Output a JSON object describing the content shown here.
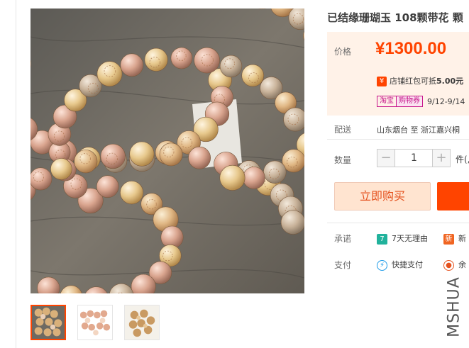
{
  "product": {
    "title": "已结缘珊瑚玉 108颗带花 颗",
    "watermark": "MSHUA"
  },
  "price": {
    "label": "价格",
    "value": "¥1300.00",
    "coupon_icon": "¥",
    "coupon_text": "店铺红包可抵",
    "coupon_amount": "5.00元",
    "promo_tag_1": "淘宝",
    "promo_tag_2": "购物券",
    "promo_dates": "9/12-9/14"
  },
  "shipping": {
    "label": "配送",
    "value": "山东烟台 至  浙江嘉兴桐"
  },
  "quantity": {
    "label": "数量",
    "minus": "−",
    "value": "1",
    "plus": "+",
    "unit": "件(,"
  },
  "actions": {
    "buy_now": "立即购买"
  },
  "promise": {
    "label": "承诺",
    "item1_icon": "7",
    "item1": "7天无理由",
    "item2_icon": "新",
    "item2": "新"
  },
  "payment": {
    "label": "支付",
    "item1": "快捷支付",
    "item2": "余"
  },
  "colors": {
    "accent": "#ff4400",
    "price_bg": "#fff2e8",
    "buy_now_bg": "#ffe4d0",
    "promo_pink": "#c7168b",
    "promise_green": "#21b29c",
    "payment_blue": "#1b9ae8"
  },
  "icons": {
    "coupon": "red-packet-icon",
    "promise_7day": "seven-day-return-icon",
    "promise_new": "new-badge-icon",
    "pay_quick": "quick-pay-icon",
    "pay_balance": "balance-pay-icon"
  }
}
